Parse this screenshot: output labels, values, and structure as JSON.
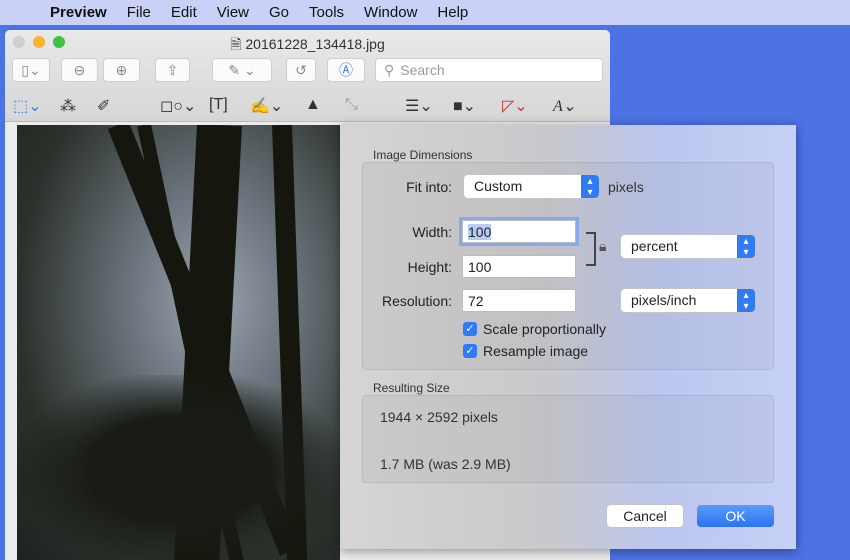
{
  "menubar": {
    "apple": "",
    "app": "Preview",
    "items": [
      "File",
      "Edit",
      "View",
      "Go",
      "Tools",
      "Window",
      "Help"
    ]
  },
  "window": {
    "title": "20161228_134418.jpg",
    "search_placeholder": "Search"
  },
  "dialog": {
    "image_dimensions_label": "Image Dimensions",
    "fit_into_label": "Fit into:",
    "fit_into_value": "Custom",
    "fit_into_unit": "pixels",
    "width_label": "Width:",
    "width_value": "100",
    "height_label": "Height:",
    "height_value": "100",
    "size_unit_value": "percent",
    "resolution_label": "Resolution:",
    "resolution_value": "72",
    "resolution_unit_value": "pixels/inch",
    "scale_proportionally": {
      "label": "Scale proportionally",
      "checked": true
    },
    "resample_image": {
      "label": "Resample image",
      "checked": true
    },
    "resulting_size_label": "Resulting Size",
    "pixel_size": "1944 × 2592 pixels",
    "file_size": "1.7 MB (was 2.9 MB)",
    "cancel": "Cancel",
    "ok": "OK"
  }
}
